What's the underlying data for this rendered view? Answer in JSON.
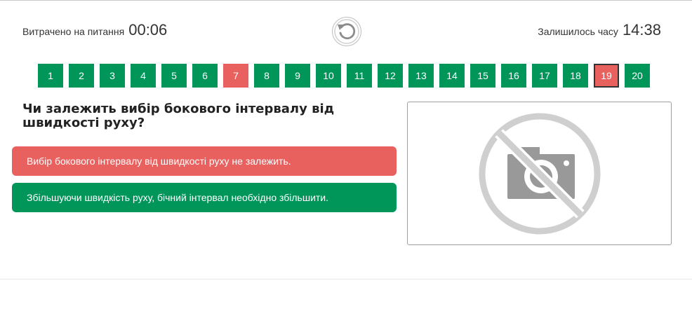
{
  "header": {
    "spent_label": "Витрачено на питання",
    "spent_time": "00:06",
    "remaining_label": "Залишилось часу",
    "remaining_time": "14:38"
  },
  "question_nav": {
    "items": [
      {
        "label": "1",
        "status": "correct"
      },
      {
        "label": "2",
        "status": "correct"
      },
      {
        "label": "3",
        "status": "correct"
      },
      {
        "label": "4",
        "status": "correct"
      },
      {
        "label": "5",
        "status": "correct"
      },
      {
        "label": "6",
        "status": "correct"
      },
      {
        "label": "7",
        "status": "wrong"
      },
      {
        "label": "8",
        "status": "correct"
      },
      {
        "label": "9",
        "status": "correct"
      },
      {
        "label": "10",
        "status": "correct"
      },
      {
        "label": "11",
        "status": "correct"
      },
      {
        "label": "12",
        "status": "correct"
      },
      {
        "label": "13",
        "status": "correct"
      },
      {
        "label": "14",
        "status": "correct"
      },
      {
        "label": "15",
        "status": "correct"
      },
      {
        "label": "16",
        "status": "correct"
      },
      {
        "label": "17",
        "status": "correct"
      },
      {
        "label": "18",
        "status": "correct"
      },
      {
        "label": "19",
        "status": "current-wrong"
      },
      {
        "label": "20",
        "status": "correct"
      }
    ]
  },
  "question": {
    "text": "Чи залежить вибір бокового інтервалу від швидкості руху?"
  },
  "answers": [
    {
      "text": "Вибір бокового інтервалу від швидкості руху не залежить.",
      "status": "wrong"
    },
    {
      "text": "Збільшуючи швидкість руху, бічний інтервал необхідно збільшити.",
      "status": "correct"
    }
  ],
  "colors": {
    "correct": "#00965a",
    "wrong": "#e8615f"
  },
  "icons": {
    "restart": "restart-icon",
    "no_image": "no-photo-icon"
  }
}
